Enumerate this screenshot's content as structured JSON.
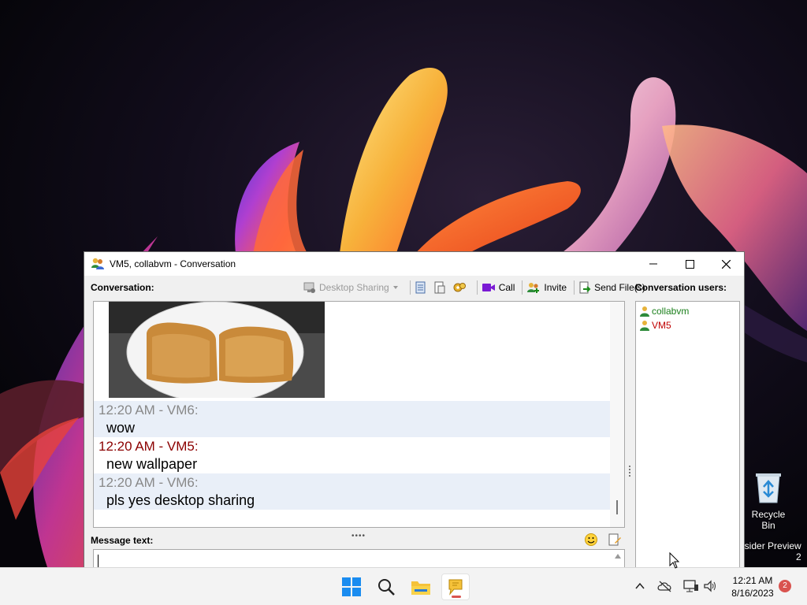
{
  "window": {
    "title": "VM5, collabvm - Conversation"
  },
  "labels": {
    "conversation": "Conversation:",
    "conversation_users": "Conversation users:",
    "message_text": "Message text:"
  },
  "toolbar": {
    "desktop_sharing": "Desktop Sharing",
    "call": "Call",
    "invite": "Invite",
    "send_files": "Send File(s)"
  },
  "messages": [
    {
      "header": "12:20 AM - VM6:",
      "text": "wow",
      "sender": "VM6"
    },
    {
      "header": "12:20 AM - VM5:",
      "text": "new wallpaper",
      "sender": "VM5"
    },
    {
      "header": "12:20 AM - VM6:",
      "text": "pls yes desktop sharing",
      "sender": "VM6"
    }
  ],
  "users": [
    {
      "name": "collabvm",
      "color": "#1a7f1a"
    },
    {
      "name": "VM5",
      "color": "#c00000"
    }
  ],
  "message_input": {
    "value": ""
  },
  "desktop": {
    "recycle_bin": "Recycle Bin",
    "insider_preview": "nsider Preview",
    "insider_suffix": "2"
  },
  "taskbar": {
    "time": "12:21 AM",
    "date": "8/16/2023",
    "notification_count": "2"
  },
  "colors": {
    "vm6_header": "#888888",
    "vm5_header": "#8b0000",
    "selected_row": "#e9eff8"
  }
}
